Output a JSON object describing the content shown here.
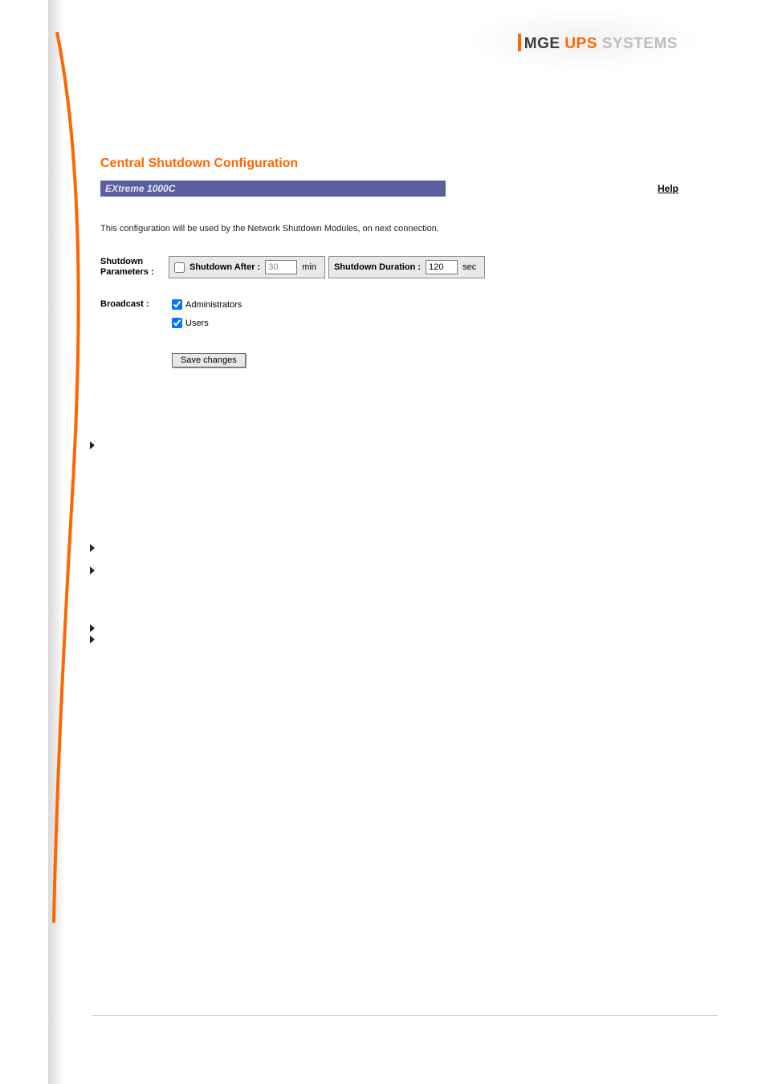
{
  "logo": {
    "mge": "MGE",
    "ups": "UPS",
    "systems": "SYSTEMS"
  },
  "title": "Central Shutdown Configuration",
  "model": "EXtreme 1000C",
  "help": "Help",
  "description": "This configuration will be used by the Network Shutdown Modules, on next connection.",
  "labels": {
    "shutdown_params": "Shutdown Parameters :",
    "shutdown_after": "Shutdown After :",
    "shutdown_duration": "Shutdown Duration :",
    "broadcast": "Broadcast :",
    "administrators": "Administrators",
    "users": "Users"
  },
  "values": {
    "shutdown_after_enabled": false,
    "shutdown_after": "30",
    "shutdown_after_unit": "min",
    "shutdown_duration": "120",
    "shutdown_duration_unit": "sec",
    "administrators_checked": true,
    "users_checked": true
  },
  "buttons": {
    "save": "Save changes"
  }
}
